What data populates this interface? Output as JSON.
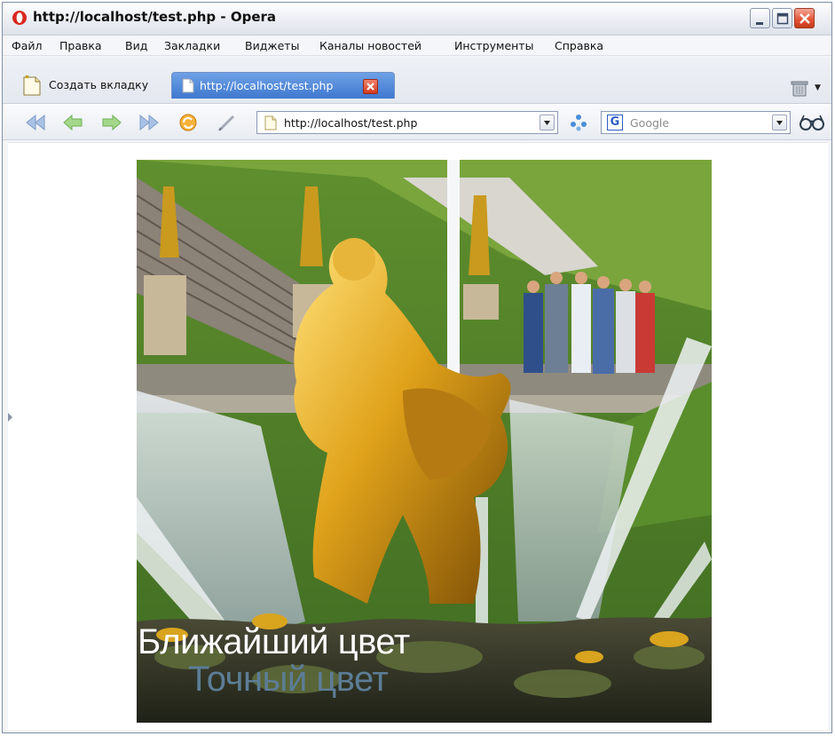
{
  "window": {
    "title": "http://localhost/test.php - Opera"
  },
  "menu": {
    "items": [
      "Файл",
      "Правка",
      "Вид",
      "Закладки",
      "Виджеты",
      "Каналы новостей",
      "Инструменты",
      "Справка"
    ]
  },
  "tabs": {
    "new_tab_label": "Создать вкладку",
    "active_tab_title": "http://localhost/test.php"
  },
  "address_bar": {
    "value": "http://localhost/test.php"
  },
  "search": {
    "engine_icon": "G",
    "placeholder": "Google"
  },
  "page": {
    "caption_nearest": "Ближайший цвет",
    "caption_exact": "Точный цвет"
  },
  "colors": {
    "tab_active": "#4a84d8",
    "caption_nearest": "#ffffff",
    "caption_exact": "#5c7d96"
  },
  "icons": {
    "toolbar": [
      "rewind-icon",
      "back-icon",
      "forward-icon",
      "fast-forward-icon",
      "reload-icon",
      "edit-icon",
      "wand-icon",
      "glasses-icon"
    ]
  }
}
